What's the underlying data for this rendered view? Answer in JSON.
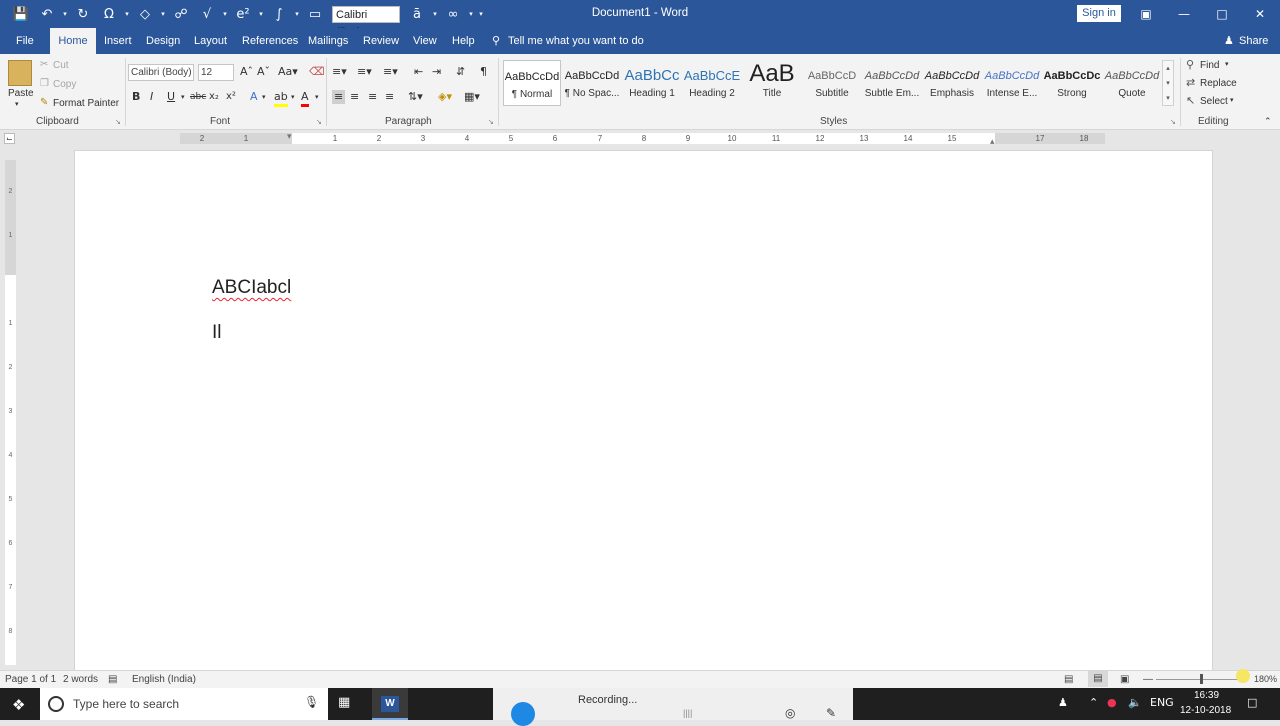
{
  "window": {
    "title": "Document1  -  Word",
    "qat_font": "Calibri (Body",
    "sign_in": "Sign in"
  },
  "tabs": [
    {
      "label": "File"
    },
    {
      "label": "Home"
    },
    {
      "label": "Insert"
    },
    {
      "label": "Design"
    },
    {
      "label": "Layout"
    },
    {
      "label": "References"
    },
    {
      "label": "Mailings"
    },
    {
      "label": "Review"
    },
    {
      "label": "View"
    },
    {
      "label": "Help"
    }
  ],
  "tell_me": "Tell me what you want to do",
  "share": "Share",
  "clipboard": {
    "paste": "Paste",
    "cut": "Cut",
    "copy": "Copy",
    "format_painter": "Format Painter",
    "group": "Clipboard"
  },
  "font": {
    "name": "Calibri (Body)",
    "size": "12",
    "group": "Font"
  },
  "paragraph": {
    "group": "Paragraph"
  },
  "styles": {
    "group": "Styles",
    "items": [
      {
        "preview": "AaBbCcDd",
        "name": "¶ Normal"
      },
      {
        "preview": "AaBbCcDd",
        "name": "¶ No Spac..."
      },
      {
        "preview": "AaBbCc",
        "name": "Heading 1"
      },
      {
        "preview": "AaBbCcE",
        "name": "Heading 2"
      },
      {
        "preview": "AaB",
        "name": "Title"
      },
      {
        "preview": "AaBbCcD",
        "name": "Subtitle"
      },
      {
        "preview": "AaBbCcDd",
        "name": "Subtle Em..."
      },
      {
        "preview": "AaBbCcDd",
        "name": "Emphasis"
      },
      {
        "preview": "AaBbCcDd",
        "name": "Intense E..."
      },
      {
        "preview": "AaBbCcDc",
        "name": "Strong"
      },
      {
        "preview": "AaBbCcDd",
        "name": "Quote"
      }
    ]
  },
  "editing": {
    "find": "Find",
    "replace": "Replace",
    "select": "Select",
    "group": "Editing"
  },
  "ruler": {
    "marks": [
      "2",
      "1",
      "1",
      "2",
      "3",
      "4",
      "5",
      "6",
      "7",
      "8",
      "9",
      "10",
      "11",
      "12",
      "13",
      "14",
      "15",
      "17",
      "18"
    ]
  },
  "vruler": {
    "marks": [
      "2",
      "1",
      "1",
      "1",
      "2",
      "3",
      "4",
      "5",
      "6",
      "7",
      "8"
    ]
  },
  "document": {
    "line1": "ABCIabcl",
    "line2": "Il"
  },
  "status": {
    "page": "Page 1 of 1",
    "words": "2 words",
    "language": "English (India)",
    "zoom": "180%"
  },
  "taskbar": {
    "search_placeholder": "Type here to search",
    "recording": "Recording...",
    "lang": "ENG",
    "time": "16:39",
    "date": "12-10-2018"
  }
}
